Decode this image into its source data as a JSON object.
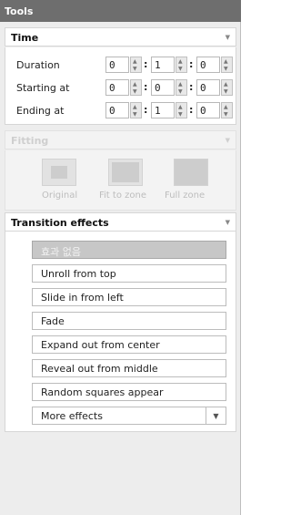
{
  "panel": {
    "title": "Tools"
  },
  "time": {
    "header": "Time",
    "rows": [
      {
        "label": "Duration",
        "values": [
          "0",
          "1",
          "0"
        ]
      },
      {
        "label": "Starting at",
        "values": [
          "0",
          "0",
          "0"
        ]
      },
      {
        "label": "Ending at",
        "values": [
          "0",
          "1",
          "0"
        ]
      }
    ]
  },
  "fitting": {
    "header": "Fitting",
    "options": [
      {
        "label": "Original"
      },
      {
        "label": "Fit to zone"
      },
      {
        "label": "Full zone"
      }
    ]
  },
  "transition": {
    "header": "Transition effects",
    "effects": [
      {
        "label": "효과 없음"
      },
      {
        "label": "Unroll from top"
      },
      {
        "label": "Slide in from left"
      },
      {
        "label": "Fade"
      },
      {
        "label": "Expand out from center"
      },
      {
        "label": "Reveal out from middle"
      },
      {
        "label": "Random squares appear"
      }
    ],
    "more": "More effects"
  }
}
